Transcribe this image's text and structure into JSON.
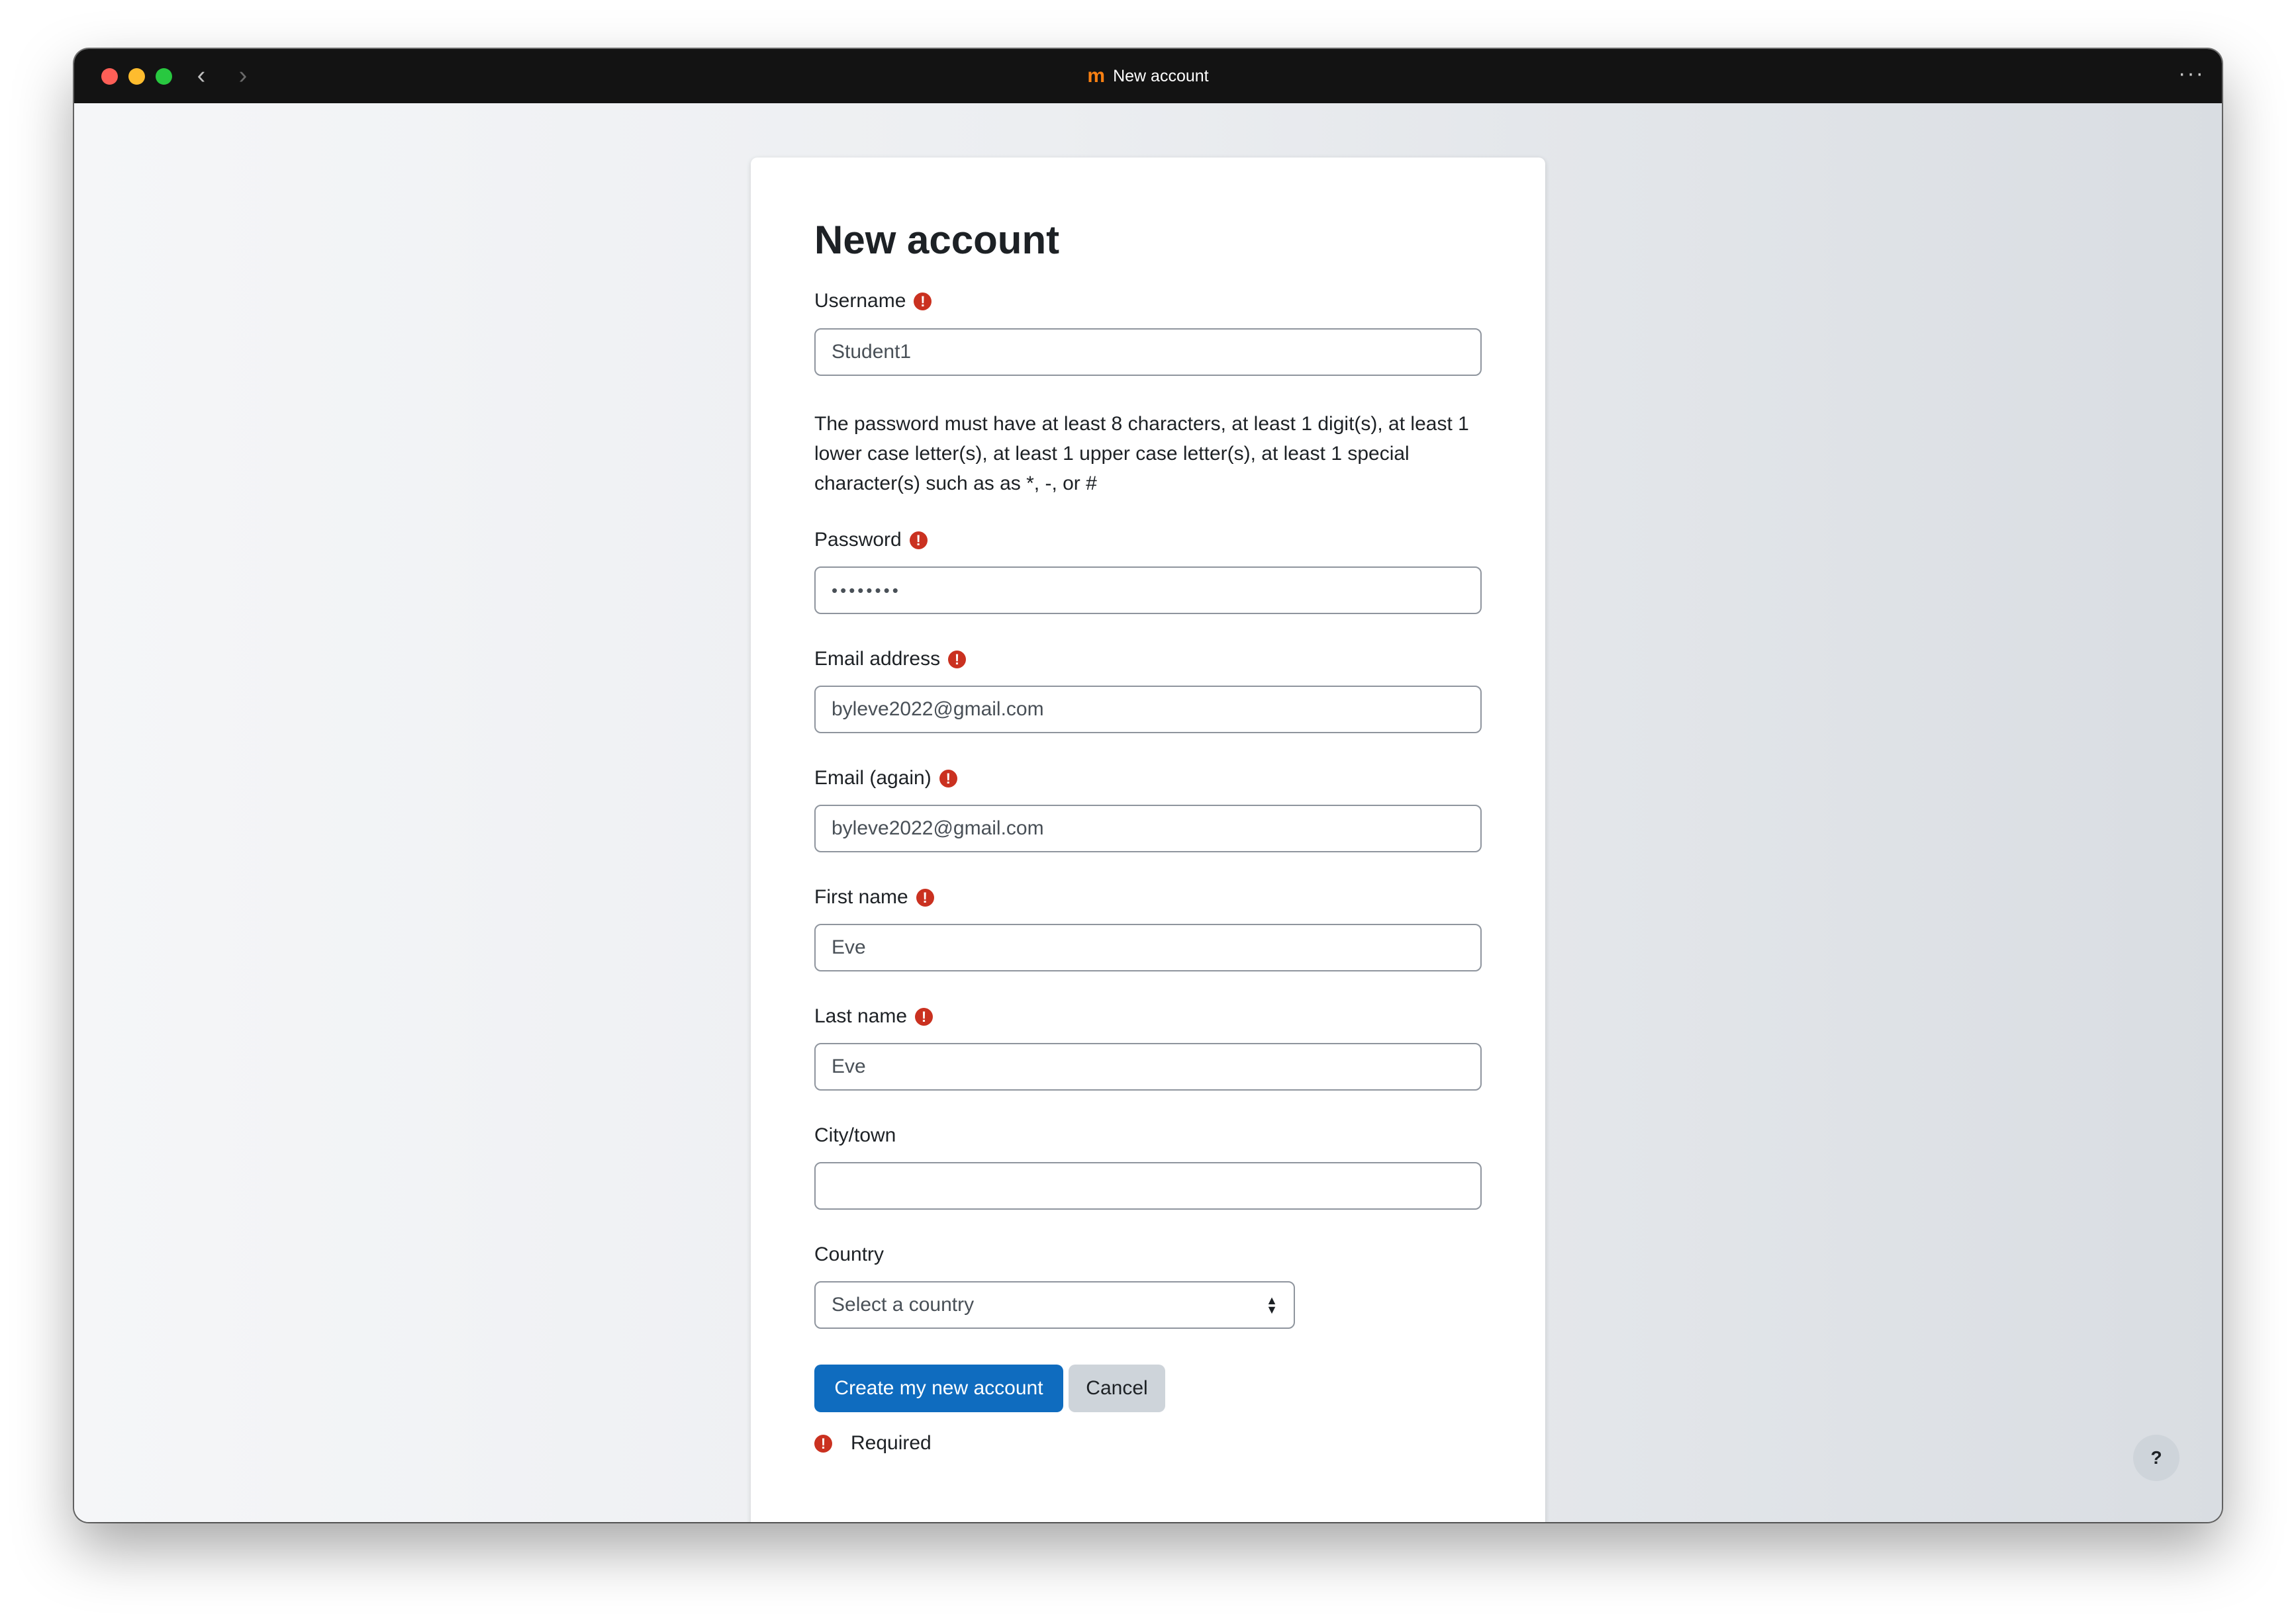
{
  "window": {
    "title": "New account",
    "logo_text": "m",
    "back_glyph": "‹",
    "forward_glyph": "›",
    "menu_glyph": "···"
  },
  "form": {
    "heading": "New account",
    "username": {
      "label": "Username",
      "value": "Student1"
    },
    "password_policy": "The password must have at least 8 characters, at least 1 digit(s), at least 1 lower case letter(s), at least 1 upper case letter(s), at least 1 special character(s) such as as *, -, or #",
    "password": {
      "label": "Password",
      "value": "••••••••"
    },
    "email": {
      "label": "Email address",
      "value": "byleve2022@gmail.com"
    },
    "email_again": {
      "label": "Email (again)",
      "value": "byleve2022@gmail.com"
    },
    "first_name": {
      "label": "First name",
      "value": "Eve"
    },
    "last_name": {
      "label": "Last name",
      "value": "Eve"
    },
    "city": {
      "label": "City/town",
      "value": ""
    },
    "country": {
      "label": "Country",
      "selected": "Select a country"
    },
    "submit_label": "Create my new account",
    "cancel_label": "Cancel",
    "required_note": "Required",
    "required_glyph": "!"
  },
  "help_button": {
    "label": "?"
  },
  "colors": {
    "primary": "#0f6cbf",
    "required": "#ca3120",
    "secondary_button": "#ced4da",
    "titlebar": "#131313"
  },
  "icons": [
    "back-arrow-icon",
    "forward-arrow-icon",
    "moodle-logo-icon",
    "more-dots-icon",
    "required-icon",
    "select-caret-icon",
    "help-icon"
  ]
}
